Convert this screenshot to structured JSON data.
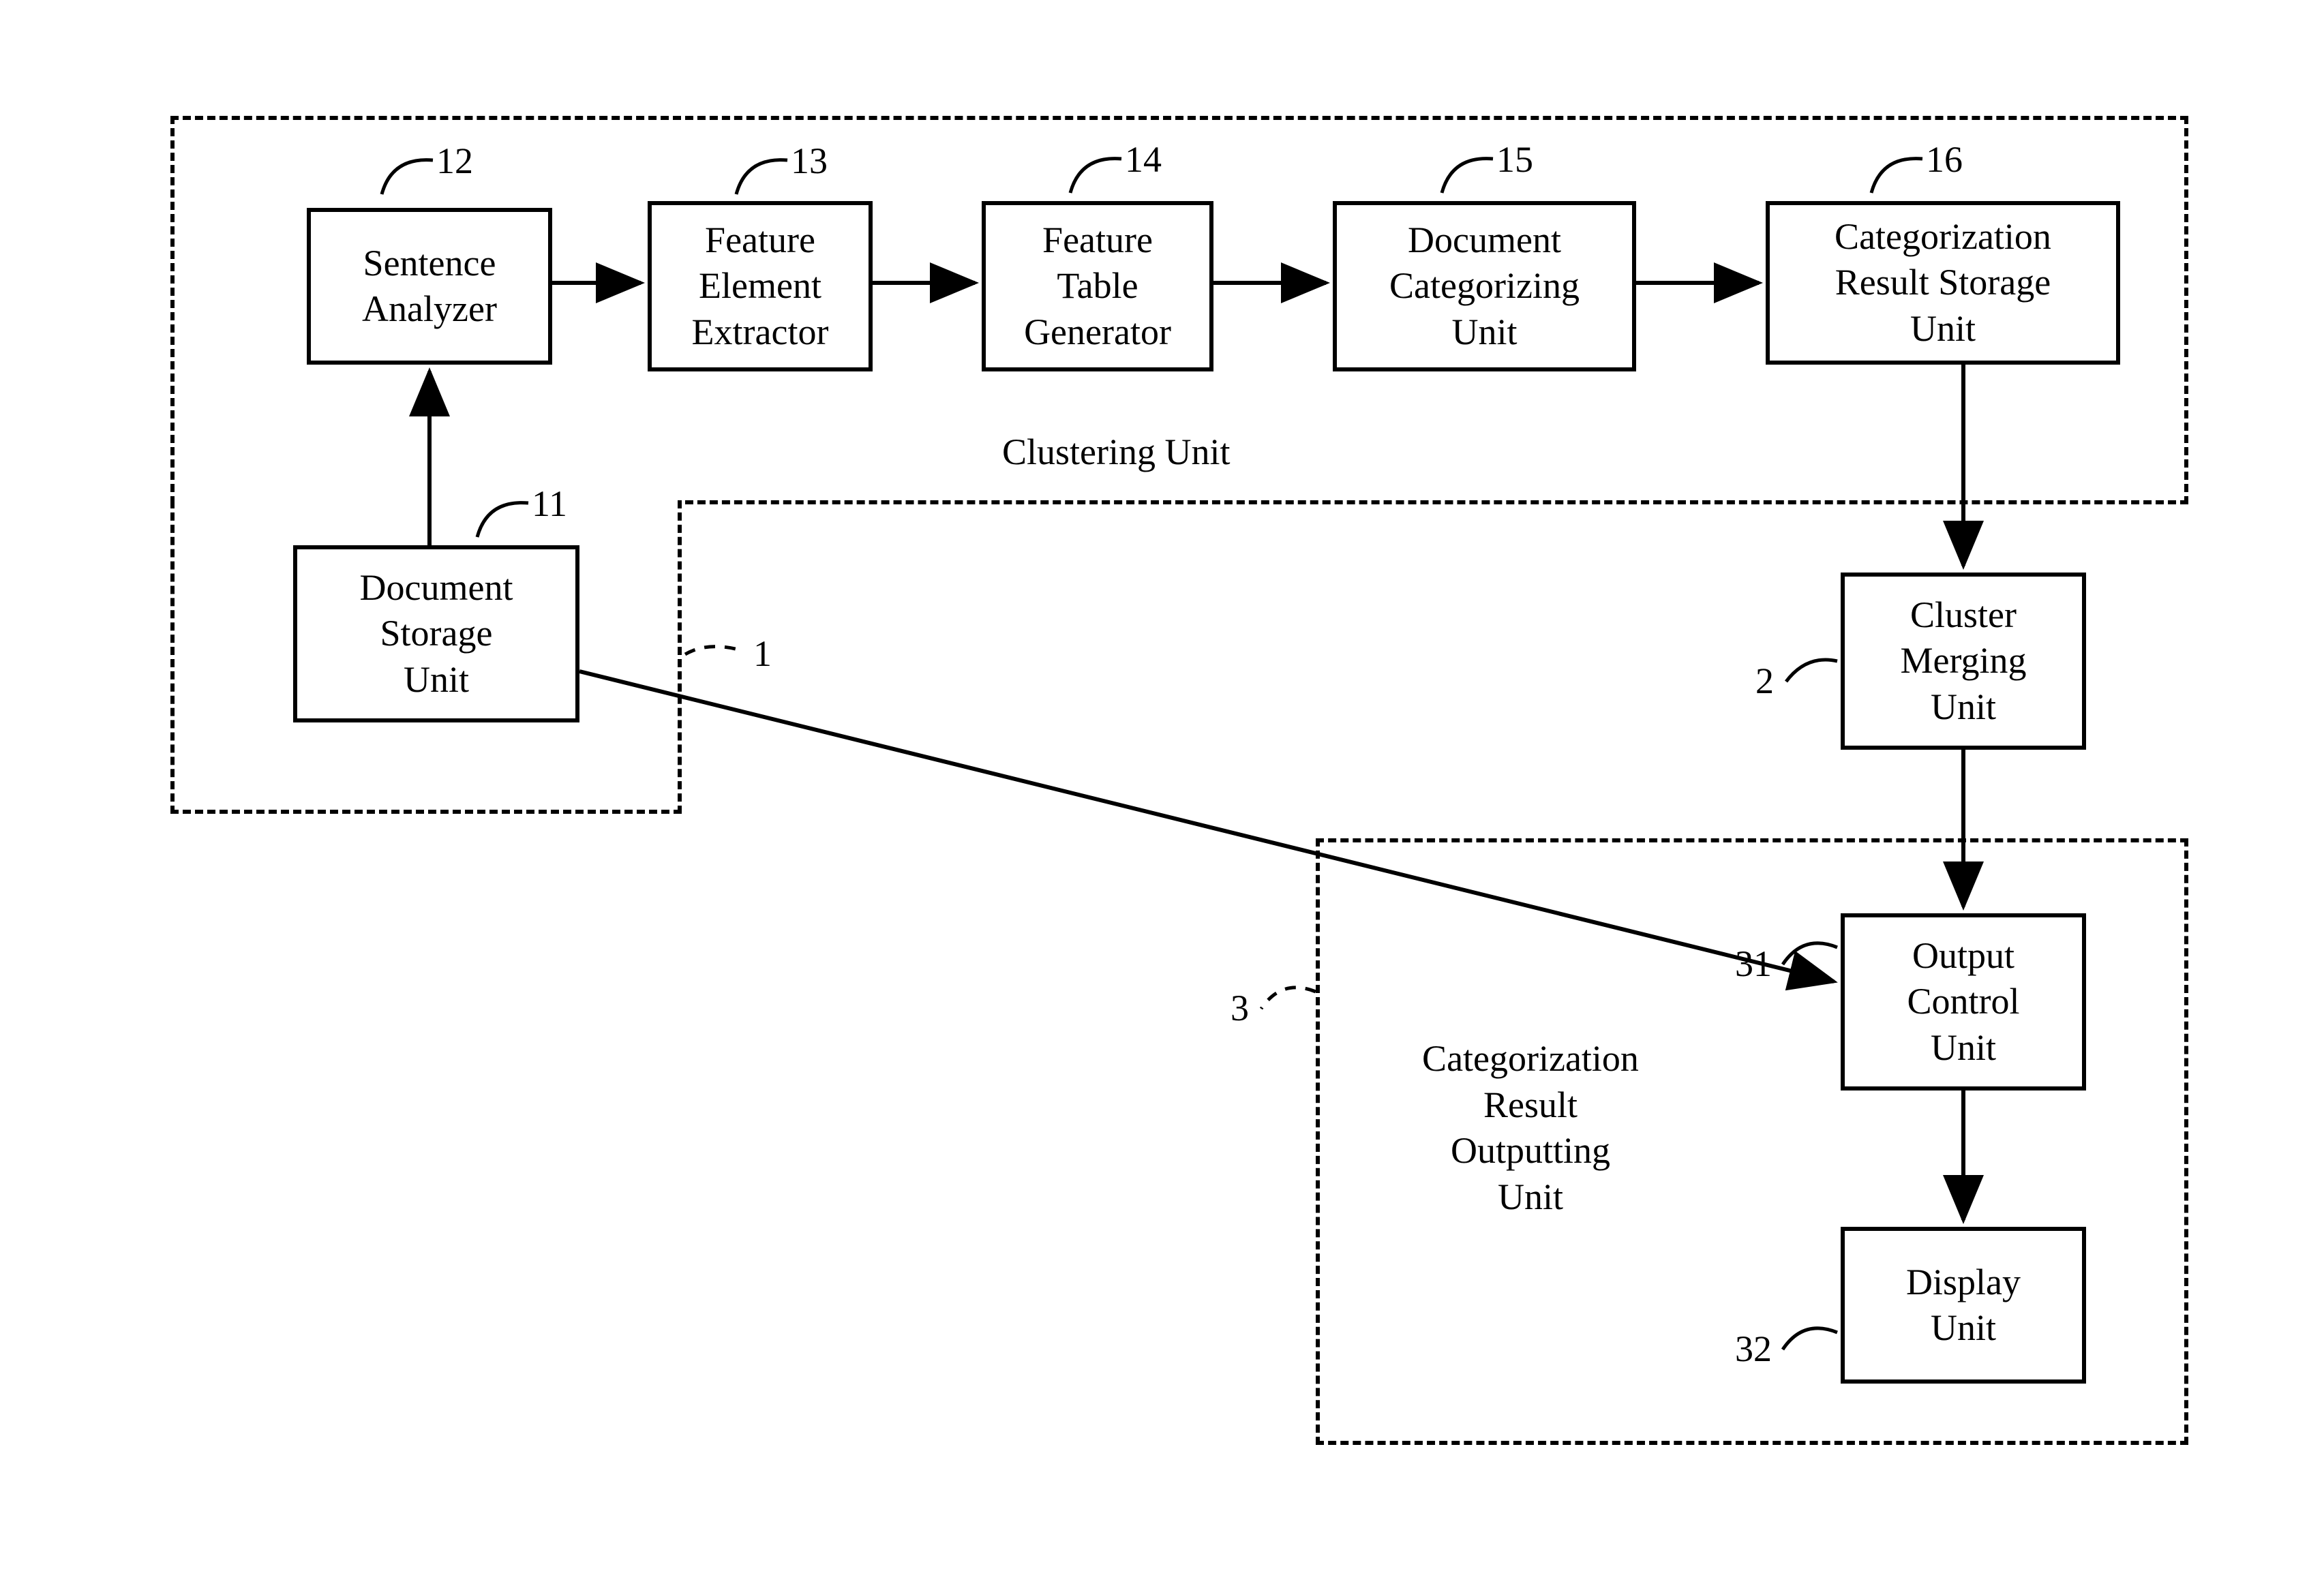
{
  "boxes": {
    "b12": {
      "label": "Sentence\nAnalyzer",
      "num": "12"
    },
    "b13": {
      "label": "Feature\nElement\nExtractor",
      "num": "13"
    },
    "b14": {
      "label": "Feature\nTable\nGenerator",
      "num": "14"
    },
    "b15": {
      "label": "Document\nCategorizing\nUnit",
      "num": "15"
    },
    "b16": {
      "label": "Categorization\nResult Storage\nUnit",
      "num": "16"
    },
    "b11": {
      "label": "Document\nStorage\nUnit",
      "num": "11"
    },
    "b2": {
      "label": "Cluster\nMerging\nUnit",
      "num": "2"
    },
    "b31": {
      "label": "Output\nControl\nUnit",
      "num": "31"
    },
    "b32": {
      "label": "Display\nUnit",
      "num": "32"
    }
  },
  "groups": {
    "clustering": {
      "label": "Clustering Unit",
      "num": "1"
    },
    "output": {
      "label": "Categorization\nResult\nOutputting\nUnit",
      "num": "3"
    }
  }
}
